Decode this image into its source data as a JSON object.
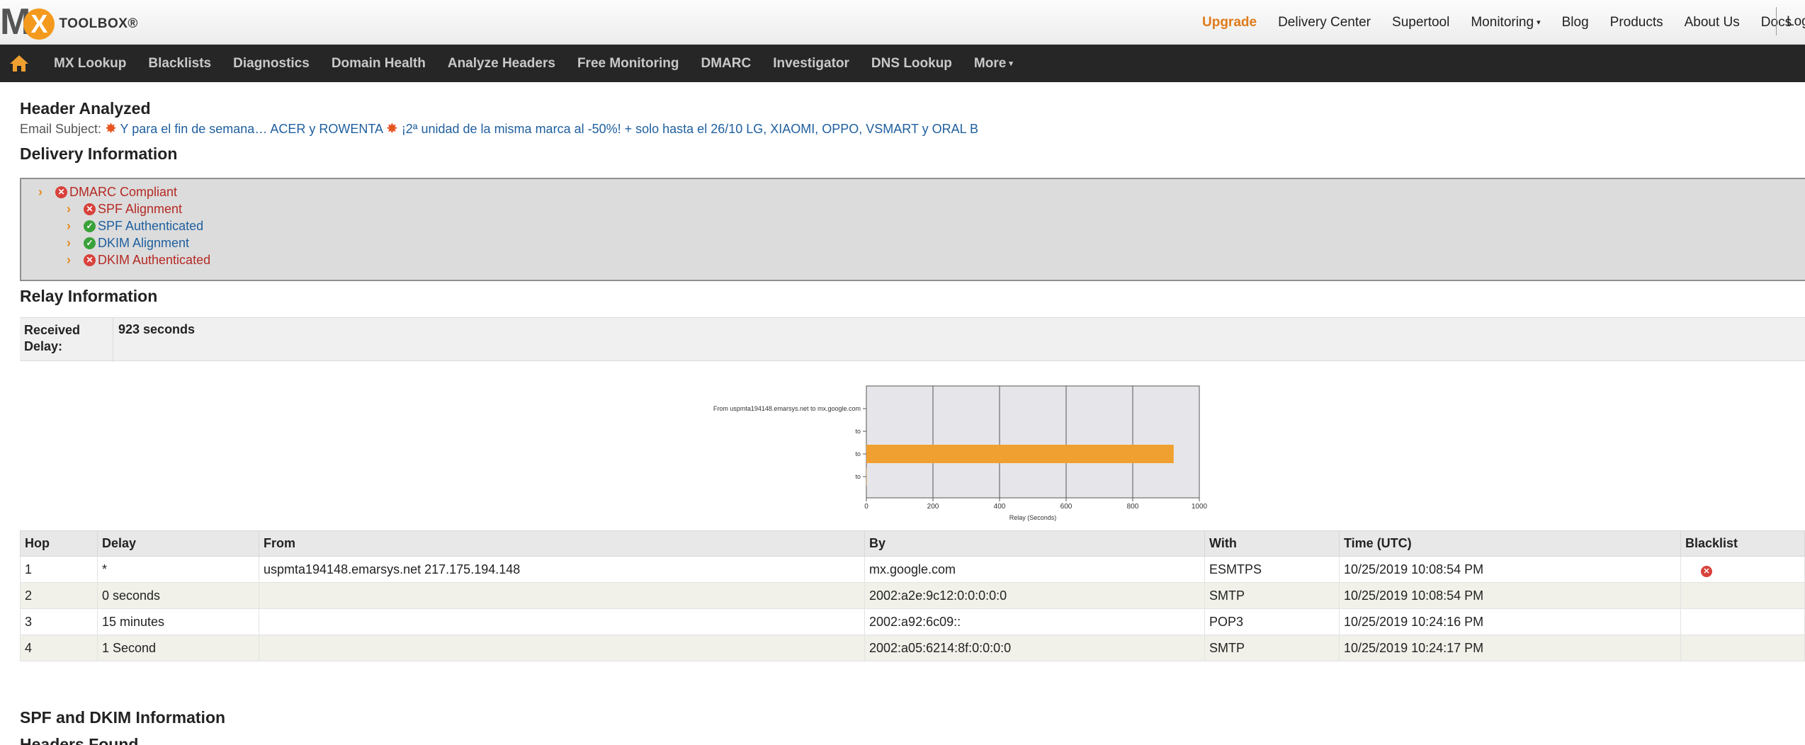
{
  "topnav": {
    "upgrade": "Upgrade",
    "items": [
      "Delivery Center",
      "Supertool",
      "Monitoring",
      "Blog",
      "Products",
      "About Us",
      "Docs"
    ],
    "login": "Log"
  },
  "logo": {
    "m": "M",
    "x": "X",
    "toolbox": "TOOLBOX®"
  },
  "mainnav": {
    "items": [
      "MX Lookup",
      "Blacklists",
      "Diagnostics",
      "Domain Health",
      "Analyze Headers",
      "Free Monitoring",
      "DMARC",
      "Investigator",
      "DNS Lookup",
      "More"
    ]
  },
  "header_analyzed": {
    "title": "Header Analyzed",
    "subject_label": "Email Subject:",
    "subject_part1": "Y para el fin de semana… ACER y ROWENTA",
    "subject_part2": "¡2ª unidad de la misma marca al -50%! + solo hasta el 26/10 LG, XIAOMI, OPPO, VSMART y ORAL B"
  },
  "delivery": {
    "title": "Delivery Information",
    "items": [
      {
        "label": "DMARC Compliant",
        "status": "fail"
      },
      {
        "label": "SPF Alignment",
        "status": "fail"
      },
      {
        "label": "SPF Authenticated",
        "status": "pass"
      },
      {
        "label": "DKIM Alignment",
        "status": "pass"
      },
      {
        "label": "DKIM Authenticated",
        "status": "fail"
      }
    ]
  },
  "relay": {
    "title": "Relay Information",
    "received_label": "Received Delay:",
    "received_value": "923 seconds"
  },
  "chart_data": {
    "type": "bar",
    "orientation": "horizontal",
    "categories": [
      "From uspmta194148.emarsys.net to mx.google.com",
      "to",
      "to",
      "to"
    ],
    "values": [
      0,
      0,
      923,
      1
    ],
    "xlabel": "Relay (Seconds)",
    "xlim": [
      0,
      1000
    ],
    "xticks": [
      0,
      200,
      400,
      600,
      800,
      1000
    ],
    "grid": true,
    "bar_color": "#f0a030"
  },
  "hops_table": {
    "columns": [
      "Hop",
      "Delay",
      "From",
      "By",
      "With",
      "Time (UTC)",
      "Blacklist"
    ],
    "rows": [
      [
        "1",
        "*",
        "uspmta194148.emarsys.net 217.175.194.148",
        "mx.google.com",
        "ESMTPS",
        "10/25/2019 10:08:54 PM",
        ""
      ],
      [
        "2",
        "0 seconds",
        "",
        "2002:a2e:9c12:0:0:0:0:0",
        "SMTP",
        "10/25/2019 10:08:54 PM",
        ""
      ],
      [
        "3",
        "15 minutes",
        "",
        "2002:a92:6c09::",
        "POP3",
        "10/25/2019 10:24:16 PM",
        ""
      ],
      [
        "4",
        "1 Second",
        "",
        "2002:a05:6214:8f:0:0:0:0",
        "SMTP",
        "10/25/2019 10:24:17 PM",
        ""
      ]
    ]
  },
  "spf_dkim": {
    "title": "SPF and DKIM Information",
    "next_title": "Headers Found"
  }
}
